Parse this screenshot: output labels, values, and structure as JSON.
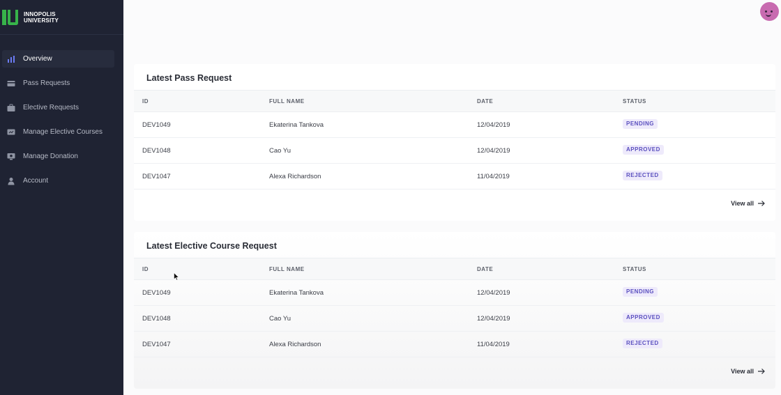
{
  "brand": {
    "line1": "INNOPOLIS",
    "line2": "UNIVERSITY"
  },
  "sidebar": {
    "items": [
      {
        "label": "Overview",
        "icon": "bar-chart-icon",
        "active": true
      },
      {
        "label": "Pass Requests",
        "icon": "card-icon",
        "active": false
      },
      {
        "label": "Elective Requests",
        "icon": "briefcase-icon",
        "active": false
      },
      {
        "label": "Manage Elective Courses",
        "icon": "presentation-icon",
        "active": false
      },
      {
        "label": "Manage Donation",
        "icon": "monitor-icon",
        "active": false
      },
      {
        "label": "Account",
        "icon": "user-icon",
        "active": false
      }
    ]
  },
  "columns": {
    "id": "ID",
    "name": "FULL NAME",
    "date": "DATE",
    "status": "STATUS"
  },
  "pass": {
    "title": "Latest Pass Request",
    "rows": [
      {
        "id": "DEV1049",
        "name": "Ekaterina Tankova",
        "date": "12/04/2019",
        "status": "PENDING"
      },
      {
        "id": "DEV1048",
        "name": "Cao Yu",
        "date": "12/04/2019",
        "status": "APPROVED"
      },
      {
        "id": "DEV1047",
        "name": "Alexa Richardson",
        "date": "11/04/2019",
        "status": "REJECTED"
      }
    ],
    "view_all": "View all"
  },
  "elective": {
    "title": "Latest Elective Course Request",
    "rows": [
      {
        "id": "DEV1049",
        "name": "Ekaterina Tankova",
        "date": "12/04/2019",
        "status": "PENDING"
      },
      {
        "id": "DEV1048",
        "name": "Cao Yu",
        "date": "12/04/2019",
        "status": "APPROVED"
      },
      {
        "id": "DEV1047",
        "name": "Alexa Richardson",
        "date": "11/04/2019",
        "status": "REJECTED"
      }
    ],
    "view_all": "View all"
  },
  "colors": {
    "sidebar_bg": "#1f2333",
    "brand_green": "#37b34a",
    "badge_bg": "#eeeafb",
    "badge_text": "#5a4fbf",
    "avatar": "#c86bb0"
  }
}
